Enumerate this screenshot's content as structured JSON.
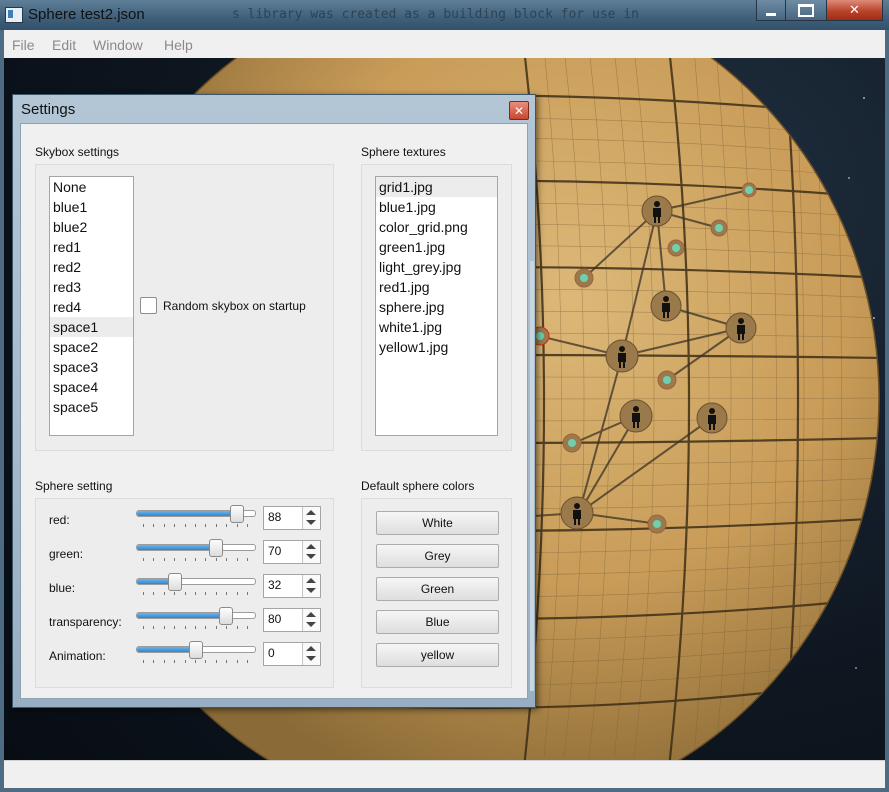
{
  "window": {
    "title": "Sphere test2.json",
    "background_text": "s library was created as a building block for use in"
  },
  "menu": [
    "File",
    "Edit",
    "Window",
    "Help"
  ],
  "settings": {
    "title": "Settings",
    "skybox": {
      "group_title": "Skybox settings",
      "items": [
        "None",
        "blue1",
        "blue2",
        "red1",
        "red2",
        "red3",
        "red4",
        "space1",
        "space2",
        "space3",
        "space4",
        "space5"
      ],
      "selected": "space1",
      "random_label": "Random skybox on startup",
      "random_checked": false
    },
    "textures": {
      "group_title": "Sphere textures",
      "items": [
        "grid1.jpg",
        "blue1.jpg",
        "color_grid.png",
        "green1.jpg",
        "light_grey.jpg",
        "red1.jpg",
        "sphere.jpg",
        "white1.jpg",
        "yellow1.jpg"
      ],
      "selected": "grid1.jpg"
    },
    "sphere_setting": {
      "group_title": "Sphere setting",
      "sliders": [
        {
          "label": "red:",
          "value": "88",
          "fraction": 0.86
        },
        {
          "label": "green:",
          "value": "70",
          "fraction": 0.68
        },
        {
          "label": "blue:",
          "value": "32",
          "fraction": 0.33
        },
        {
          "label": "transparency:",
          "value": "80",
          "fraction": 0.76
        },
        {
          "label": "Animation:",
          "value": "0",
          "fraction": 0.51
        }
      ]
    },
    "colors": {
      "group_title": "Default sphere colors",
      "buttons": [
        "White",
        "Grey",
        "Green",
        "Blue",
        "yellow"
      ]
    }
  },
  "colors": {
    "sphere": "#c9a060",
    "grid": "#5a4528",
    "slider_fill": "#3a8fd8",
    "node": "#6fcfb0"
  }
}
